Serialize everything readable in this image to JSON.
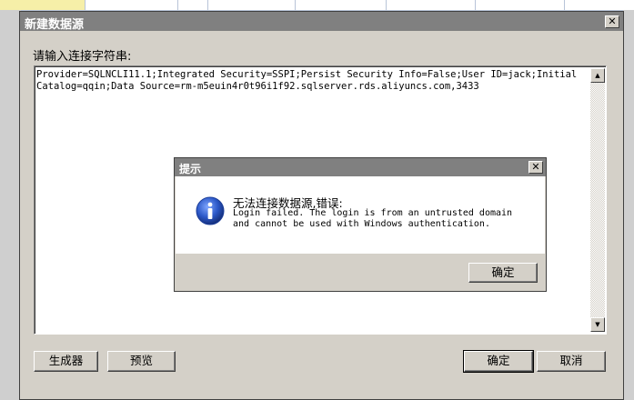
{
  "dialog": {
    "title": "新建数据源",
    "prompt_label": "请输入连接字符串:",
    "connection_string": "Provider=SQLNCLI11.1;Integrated Security=SSPI;Persist Security Info=False;User ID=jack;Initial Catalog=qqin;Data Source=rm-m5euin4r0t96i1f92.sqlserver.rds.aliyuncs.com,3433",
    "buttons": {
      "generator": "生成器",
      "preview": "预览",
      "ok": "确定",
      "cancel": "取消"
    }
  },
  "message_box": {
    "title": "提示",
    "message_title": "无法连接数据源,错误:",
    "message_detail": "Login failed. The login is from an untrusted domain\nand cannot be used with Windows authentication.",
    "ok_button": "确定",
    "icon": "info-icon"
  },
  "colors": {
    "titlebar_inactive": "#808080",
    "dialog_face": "#d4d0c8",
    "info_blue": "#2b57c7"
  }
}
